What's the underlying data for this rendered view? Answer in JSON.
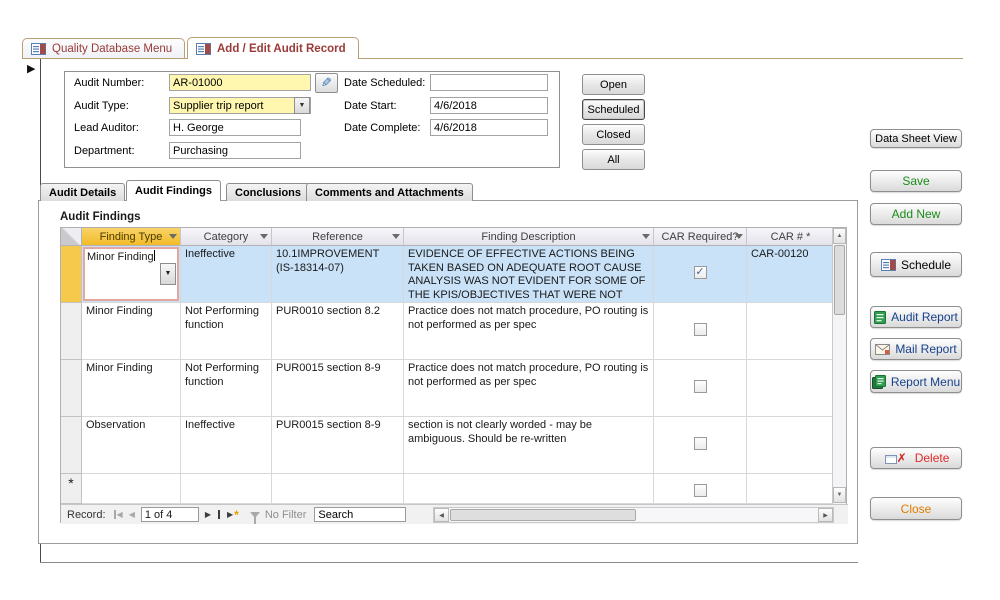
{
  "window_tabs": {
    "tab1": "Quality Database Menu",
    "tab2": "Add / Edit Audit Record"
  },
  "form": {
    "audit_number_label": "Audit Number:",
    "audit_number_value": "AR-01000",
    "audit_type_label": "Audit Type:",
    "audit_type_value": "Supplier trip report",
    "lead_auditor_label": "Lead Auditor:",
    "lead_auditor_value": "H. George",
    "department_label": "Department:",
    "department_value": "Purchasing",
    "date_scheduled_label": "Date Scheduled:",
    "date_scheduled_value": "",
    "date_start_label": "Date Start:",
    "date_start_value": "4/6/2018",
    "date_complete_label": "Date Complete:",
    "date_complete_value": "4/6/2018"
  },
  "status_buttons": {
    "open": "Open",
    "scheduled": "Scheduled",
    "closed": "Closed",
    "all": "All"
  },
  "inner_tabs": {
    "details": "Audit Details",
    "findings": "Audit Findings",
    "conclusions": "Conclusions",
    "comments": "Comments and Attachments"
  },
  "findings": {
    "section_title": "Audit Findings",
    "columns": {
      "finding_type": "Finding Type",
      "category": "Category",
      "reference": "Reference",
      "description": "Finding Description",
      "car_required": "CAR Required?",
      "car_number": "CAR # *"
    },
    "rows": [
      {
        "finding_type": "Minor Finding",
        "category": "Ineffective",
        "reference": "10.1IMPROVEMENT (IS-18314-07)",
        "description": "EVIDENCE OF EFFECTIVE ACTIONS BEING TAKEN BASED ON ADEQUATE ROOT CAUSE ANALYSIS WAS NOT EVIDENT FOR SOME OF THE KPIS/OBJECTIVES THAT WERE NOT MET. THIS",
        "car_mark": "✓",
        "car_number": "CAR-00120"
      },
      {
        "finding_type": "Minor Finding",
        "category": "Not Performing function",
        "reference": "PUR0010 section 8.2",
        "description": "Practice does not match procedure, PO routing is not performed as per spec",
        "car_mark": "",
        "car_number": ""
      },
      {
        "finding_type": "Minor Finding",
        "category": "Not Performing function",
        "reference": "PUR0015 section 8-9",
        "description": "Practice does not match procedure, PO routing is not performed as per spec",
        "car_mark": "",
        "car_number": ""
      },
      {
        "finding_type": "Observation",
        "category": "Ineffective",
        "reference": "PUR0015 section 8-9",
        "description": "section is not clearly worded - may be ambiguous.  Should be re-written",
        "car_mark": "",
        "car_number": ""
      }
    ],
    "new_row_indicator": "*"
  },
  "record_nav": {
    "label": "Record:",
    "position": "1 of 4",
    "filter_label": "No Filter",
    "search_value": "Search"
  },
  "action_buttons": {
    "datasheet": "Data Sheet View",
    "save": "Save",
    "add_new": "Add New",
    "schedule": "Schedule",
    "audit_report": "Audit Report",
    "mail_report": "Mail Report",
    "report_menu": "Report Menu",
    "delete": "Delete",
    "close": "Close"
  },
  "icons": {
    "dropdown": "▼",
    "record_selector": "▶",
    "nav_prev": "◀",
    "nav_next": "▶",
    "scroll_up": "▲",
    "scroll_down": "▼",
    "scroll_left": "◀",
    "scroll_right": "▶",
    "pencil": "✎",
    "delete_x": "✗",
    "new_record_star": "*"
  },
  "colors": {
    "accent_yellow": "#FFF7B0",
    "header_gold": "#F2BB27",
    "selected_row": "#C9E2F8",
    "tab_text": "#9A3B38",
    "save_green": "#1A8C1A",
    "report_navy": "#16418C",
    "delete_red": "#E02B2B",
    "close_orange": "#E07C00"
  }
}
